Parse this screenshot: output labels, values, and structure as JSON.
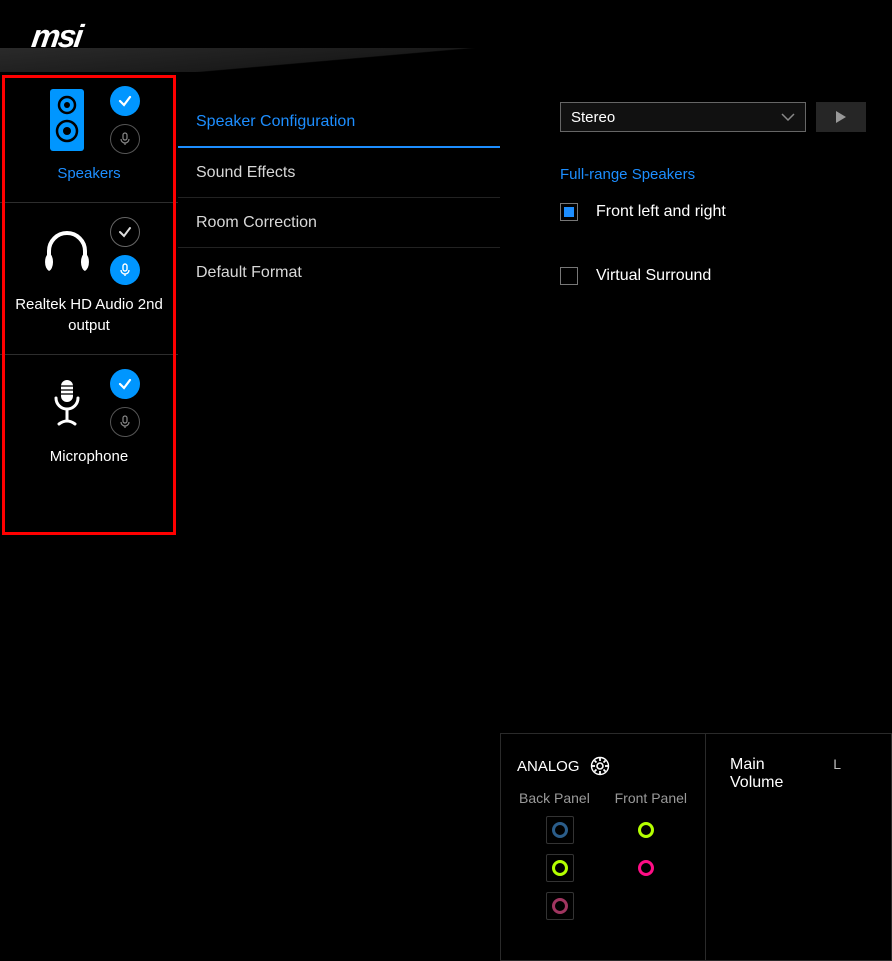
{
  "brand": "msi",
  "sidebar": {
    "devices": [
      {
        "label": "Speakers",
        "active": true,
        "check_active": true,
        "mic_active": false
      },
      {
        "label": "Realtek HD Audio 2nd output",
        "active": false,
        "check_active": false,
        "mic_active": true
      },
      {
        "label": "Microphone",
        "active": false,
        "check_active": true,
        "mic_active": false
      }
    ]
  },
  "tabs": [
    {
      "label": "Speaker Configuration",
      "active": true
    },
    {
      "label": "Sound Effects",
      "active": false
    },
    {
      "label": "Room Correction",
      "active": false
    },
    {
      "label": "Default Format",
      "active": false
    }
  ],
  "config": {
    "dropdown_value": "Stereo",
    "section_label": "Full-range Speakers",
    "options": [
      {
        "label": "Front left and right",
        "checked": true
      },
      {
        "label": "Virtual Surround",
        "checked": false
      }
    ]
  },
  "analog": {
    "title": "ANALOG",
    "back_label": "Back Panel",
    "front_label": "Front Panel",
    "back_jacks": [
      {
        "color": "#2b5d8a"
      },
      {
        "color": "#b4ff00"
      },
      {
        "color": "#a03560"
      }
    ],
    "front_jacks": [
      {
        "color": "#b4ff00"
      },
      {
        "color": "#ff0d86"
      }
    ]
  },
  "volume": {
    "label": "Main Volume",
    "channel": "L"
  }
}
